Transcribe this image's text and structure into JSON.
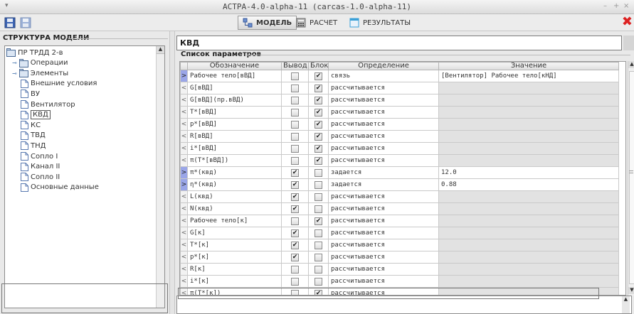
{
  "window": {
    "title": "ACTPA-4.0-alpha-11 (carcas-1.0-alpha-11)",
    "controls": [
      "–",
      "+",
      "×"
    ]
  },
  "toolbar": {
    "tabs": [
      {
        "label": "МОДЕЛЬ",
        "active": true
      },
      {
        "label": "РАСЧЕТ",
        "active": false
      },
      {
        "label": "РЕЗУЛЬТАТЫ",
        "active": false
      }
    ],
    "close_icon": "✖"
  },
  "left": {
    "title": "СТРУКТУРА МОДЕЛИ",
    "tree": [
      {
        "label": "ПР ТРДД 2-в",
        "level": 0,
        "type": "folder",
        "expander": ""
      },
      {
        "label": "Операции",
        "level": 1,
        "type": "folder",
        "expander": "⊸"
      },
      {
        "label": "Элементы",
        "level": 1,
        "type": "folder",
        "expander": "⊸"
      },
      {
        "label": "Внешние условия",
        "level": 2,
        "type": "doc"
      },
      {
        "label": "ВУ",
        "level": 2,
        "type": "doc"
      },
      {
        "label": "Вентилятор",
        "level": 2,
        "type": "doc"
      },
      {
        "label": "КВД",
        "level": 2,
        "type": "doc",
        "selected": true
      },
      {
        "label": "КС",
        "level": 2,
        "type": "doc"
      },
      {
        "label": "ТВД",
        "level": 2,
        "type": "doc"
      },
      {
        "label": "ТНД",
        "level": 2,
        "type": "doc"
      },
      {
        "label": "Сопло I",
        "level": 2,
        "type": "doc"
      },
      {
        "label": "Канал II",
        "level": 2,
        "type": "doc"
      },
      {
        "label": "Сопло II",
        "level": 2,
        "type": "doc"
      },
      {
        "label": "Основные данные",
        "level": 2,
        "type": "doc"
      }
    ]
  },
  "right": {
    "name": "КВД",
    "params_title": "Список параметров",
    "columns": [
      "Обозначение",
      "Вывод",
      "Блок",
      "Определение",
      "Значение"
    ],
    "rows": [
      {
        "dir": ">",
        "name": "Рабочее тело[вВД]",
        "output": false,
        "block": true,
        "definition": "связь",
        "value": "[Вентилятор] Рабочее тело[кНД]",
        "selected": true
      },
      {
        "dir": "<",
        "name": "G[вВД]",
        "output": false,
        "block": true,
        "definition": "рассчитывается",
        "value": ""
      },
      {
        "dir": "<",
        "name": "G[вВД](пр.вВД)",
        "output": false,
        "block": true,
        "definition": "рассчитывается",
        "value": ""
      },
      {
        "dir": "<",
        "name": "T*[вВД]",
        "output": false,
        "block": true,
        "definition": "рассчитывается",
        "value": ""
      },
      {
        "dir": "<",
        "name": "p*[вВД]",
        "output": false,
        "block": true,
        "definition": "рассчитывается",
        "value": ""
      },
      {
        "dir": "<",
        "name": "R[вВД]",
        "output": false,
        "block": true,
        "definition": "рассчитывается",
        "value": ""
      },
      {
        "dir": "<",
        "name": "i*[вВД]",
        "output": false,
        "block": true,
        "definition": "рассчитывается",
        "value": ""
      },
      {
        "dir": "<",
        "name": "π(T*[вВД])",
        "output": false,
        "block": true,
        "definition": "рассчитывается",
        "value": ""
      },
      {
        "dir": ">",
        "name": "π*(квд)",
        "output": true,
        "block": false,
        "definition": "задается",
        "value": "12.0",
        "editable": true
      },
      {
        "dir": ">",
        "name": "η*(квд)",
        "output": true,
        "block": false,
        "definition": "задается",
        "value": "0.88",
        "editable": true
      },
      {
        "dir": "<",
        "name": "L(квд)",
        "output": true,
        "block": false,
        "definition": "рассчитывается",
        "value": ""
      },
      {
        "dir": "<",
        "name": "N(квд)",
        "output": true,
        "block": false,
        "definition": "рассчитывается",
        "value": ""
      },
      {
        "dir": "<",
        "name": "Рабочее тело[к]",
        "output": false,
        "block": true,
        "definition": "рассчитывается",
        "value": ""
      },
      {
        "dir": "<",
        "name": "G[к]",
        "output": true,
        "block": false,
        "definition": "рассчитывается",
        "value": ""
      },
      {
        "dir": "<",
        "name": "T*[к]",
        "output": true,
        "block": false,
        "definition": "рассчитывается",
        "value": ""
      },
      {
        "dir": "<",
        "name": "p*[к]",
        "output": true,
        "block": false,
        "definition": "рассчитывается",
        "value": ""
      },
      {
        "dir": "<",
        "name": "R[к]",
        "output": false,
        "block": false,
        "definition": "рассчитывается",
        "value": ""
      },
      {
        "dir": "<",
        "name": "i*[к]",
        "output": false,
        "block": false,
        "definition": "рассчитывается",
        "value": ""
      },
      {
        "dir": "<",
        "name": "π(T*[к])",
        "output": false,
        "block": true,
        "definition": "рассчитывается",
        "value": ""
      }
    ]
  },
  "colors": {
    "active_row_arrow": "#9aa6e8",
    "close": "#d22222"
  }
}
